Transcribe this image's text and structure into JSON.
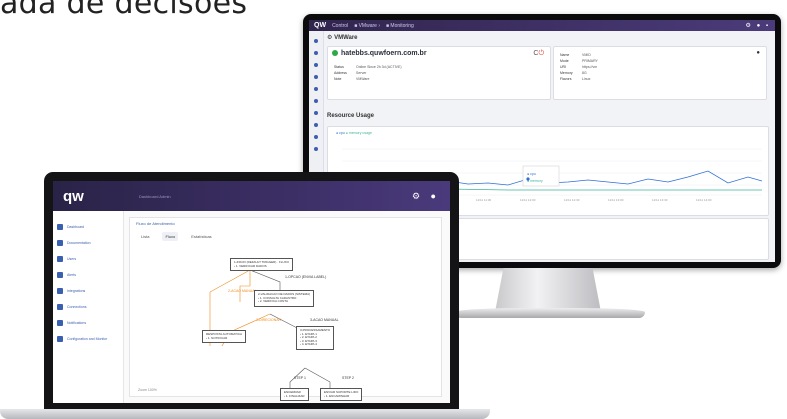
{
  "headline": "ada de decisões",
  "monitor": {
    "brand": "QW",
    "crumbs": [
      "Control",
      "■ VMware ›",
      "■ Monitoring"
    ],
    "vm_title": "VMWare",
    "host": "hatebbs.quwfoern.com.br",
    "details": [
      {
        "k": "Status",
        "v": "Online Since 2h 3d (ACTIVE)"
      },
      {
        "k": "Address",
        "v": "Server"
      },
      {
        "k": "Note",
        "v": "VMWare"
      }
    ],
    "side_details": [
      {
        "k": "Name",
        "v": "VMID"
      },
      {
        "k": "Mode",
        "v": "PRIMARY"
      },
      {
        "k": "URI",
        "v": "https://vm"
      },
      {
        "k": "Memory",
        "v": "8G"
      },
      {
        "k": "Flavors",
        "v": "Linux"
      }
    ],
    "resource_title": "Resource Usage",
    "legend": [
      "● cpu",
      "● memory usage"
    ],
    "tooltip": [
      "● cpu",
      "● memory"
    ],
    "colors": {
      "cpu": "#2f6fd6",
      "memory": "#3fb59a",
      "accent": "#4b3b7a"
    }
  },
  "laptop": {
    "brand": "qw",
    "subtitle": "Dashboard Admin",
    "sidebar": [
      "Dashboard",
      "Documentation",
      "Users",
      "Alerts",
      "Integrations",
      "Connections",
      "Notifications",
      "Configuration and Monitor"
    ],
    "panel_title": "Fluxo de Atendimento",
    "tabs": [
      "Lista",
      "Fluxo",
      "Estatísticas"
    ],
    "nodes": {
      "n1": [
        "1-INICIO (DEFAULT TRIGGER) · FLUXO",
        "› 1. VERIFICAR DADOS"
      ],
      "n2": [
        "2-VALIDACAO DE DADOS (SISTEMA)",
        "› 1. CONSULTA CADASTRO",
        "› 2. VERIFICA CONTA"
      ],
      "n3": [
        "RESPOSTA AUTOMATICA",
        "› 1. NOTIFICAR"
      ],
      "n4": [
        "3-PROCESSAMENTO",
        "› 1. ETAPA 1",
        "› 2. ETAPA 2",
        "› 3. ETAPA 3",
        "› 4. ETAPA 4"
      ],
      "n5": [
        "ENCERRAR",
        "› 1. FINALIZAR"
      ],
      "n6": [
        "ENVIAR SUPORTE LIDO",
        "› 1. ENCAMINHAR"
      ]
    },
    "edges": {
      "e1": "1-OPCAO (ENVIA LABEL)",
      "e2": "2-ACAO MANUAL",
      "e3": "3-DIRECIONAR",
      "e4": "3-ACAO MANUAL",
      "e5": "STEP 1",
      "e6": "STEP 2"
    },
    "footer": "Zoom 100%"
  }
}
